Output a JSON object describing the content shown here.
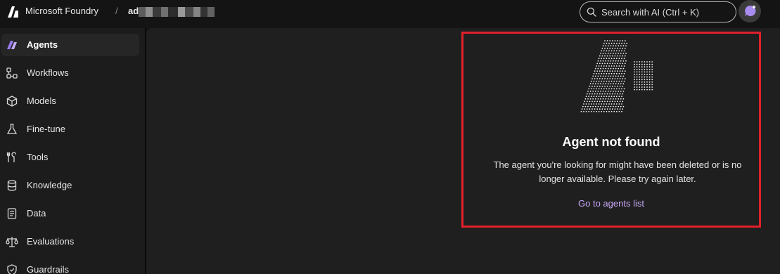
{
  "header": {
    "brand": "Microsoft Foundry",
    "separator": "/",
    "project_prefix": "ad",
    "logo_icon": "foundry-logo-icon",
    "search": {
      "placeholder": "Search with AI (Ctrl + K)",
      "icon": "search-icon"
    },
    "assistant_icon": "copilot-chat-icon"
  },
  "sidebar": {
    "items": [
      {
        "label": "Agents",
        "icon": "agents-icon",
        "active": true
      },
      {
        "label": "Workflows",
        "icon": "workflows-icon",
        "active": false
      },
      {
        "label": "Models",
        "icon": "models-icon",
        "active": false
      },
      {
        "label": "Fine-tune",
        "icon": "flask-icon",
        "active": false
      },
      {
        "label": "Tools",
        "icon": "tools-icon",
        "active": false
      },
      {
        "label": "Knowledge",
        "icon": "database-icon",
        "active": false
      },
      {
        "label": "Data",
        "icon": "document-icon",
        "active": false
      },
      {
        "label": "Evaluations",
        "icon": "scales-icon",
        "active": false
      },
      {
        "label": "Guardrails",
        "icon": "shield-icon",
        "active": false
      }
    ]
  },
  "main": {
    "illustration_icon": "dotted-document-illustration-icon",
    "title": "Agent not found",
    "description": "The agent you're looking for might have been deleted or is no longer available. Please try again later.",
    "link_label": "Go to agents list"
  },
  "colors": {
    "background": "#141414",
    "sidebar": "#1c1c1c",
    "main": "#1f1f1f",
    "accent": "#c6a8f5",
    "highlight": "#e0202a",
    "brand_purple": "#7b5cf0"
  }
}
